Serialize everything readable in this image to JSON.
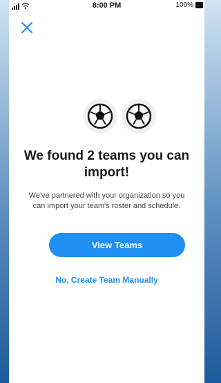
{
  "status_bar": {
    "time": "8:00 PM",
    "battery_percent": "100%",
    "icons": [
      "signal-icon",
      "wifi-icon",
      "battery-icon"
    ]
  },
  "header": {
    "close_icon": "close-icon"
  },
  "hero": {
    "icons": [
      "soccer-ball-icon",
      "soccer-ball-icon"
    ]
  },
  "content": {
    "headline_line1": "We found 2 teams you can",
    "headline_line2": "import!",
    "description_line1": "We've partnered with your organization so you",
    "description_line2": "can import your team's roster and schedule."
  },
  "actions": {
    "primary_label": "View Teams",
    "secondary_label": "No, Create Team Manually"
  },
  "colors": {
    "accent": "#1f8ff0",
    "text": "#1a1a1a",
    "background": "#ffffff"
  }
}
